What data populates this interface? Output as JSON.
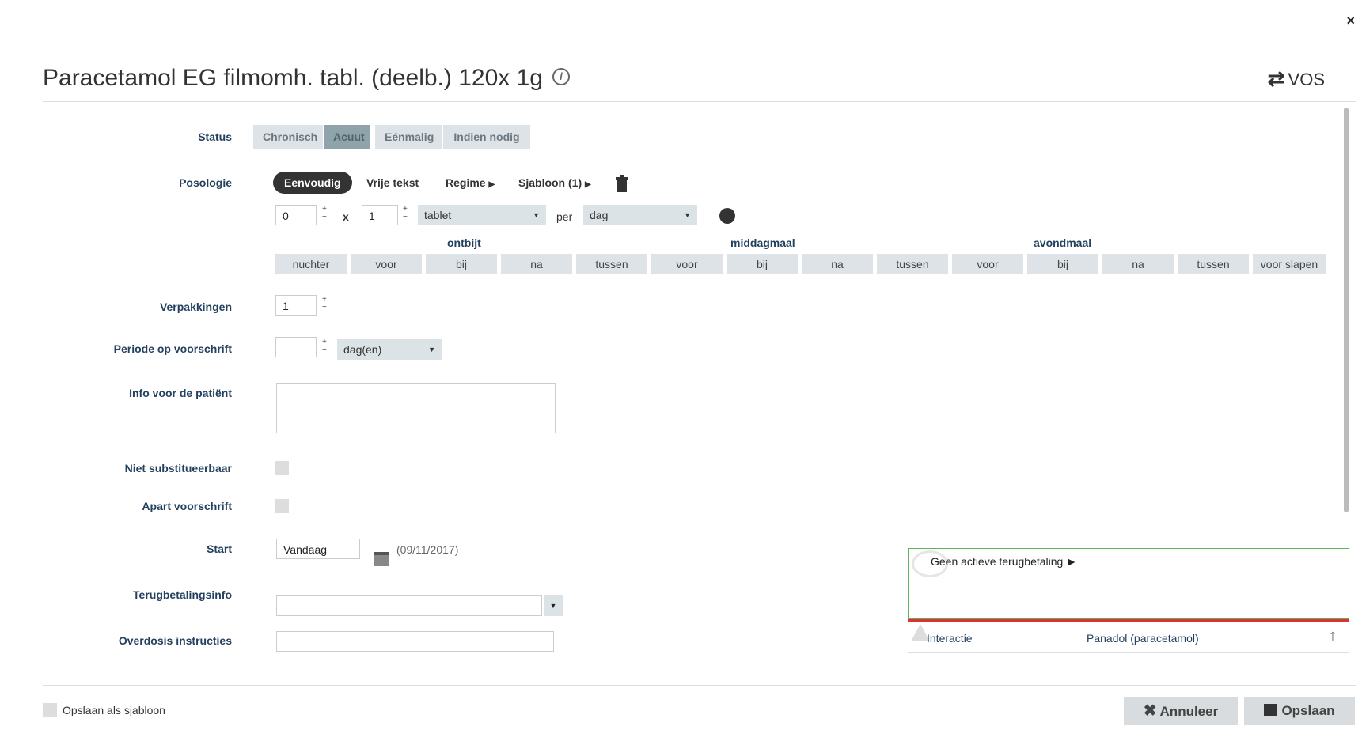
{
  "header": {
    "title": "Paracetamol EG filmomh. tabl. (deelb.) 120x 1g",
    "info_icon": "ⓘ",
    "vos_label": "VOS",
    "swap_icon": "⇄",
    "close_icon": "×"
  },
  "labels": {
    "status": "Status",
    "posologie": "Posologie",
    "verpakkingen": "Verpakkingen",
    "periode": "Periode op voorschrift",
    "info_patient": "Info voor de patiënt",
    "niet_subst": "Niet substitueerbaar",
    "apart": "Apart voorschrift",
    "start": "Start",
    "terugbetaling": "Terugbetalingsinfo",
    "overdosis": "Overdosis instructies"
  },
  "status": {
    "options": [
      "Chronisch",
      "Acuut",
      "Eénmalig",
      "Indien nodig"
    ],
    "selected": "Acuut"
  },
  "posologie_tabs": {
    "eenvoudig": "Eenvoudig",
    "vrije_tekst": "Vrije tekst",
    "regime": "Regime",
    "sjabloon": "Sjabloon (1)"
  },
  "dosage": {
    "amount": "0",
    "times_label": "x",
    "quantity": "1",
    "unit": "tablet",
    "per_label": "per",
    "period": "dag"
  },
  "meals": {
    "ontbijt": "ontbijt",
    "middagmaal": "middagmaal",
    "avondmaal": "avondmaal"
  },
  "slots": [
    "nuchter",
    "voor",
    "bij",
    "na",
    "tussen",
    "voor",
    "bij",
    "na",
    "tussen",
    "voor",
    "bij",
    "na",
    "tussen",
    "voor slapen"
  ],
  "verpakkingen_value": "1",
  "periode": {
    "value": "",
    "unit": "dag(en)"
  },
  "start": {
    "value": "Vandaag",
    "date": "(09/11/2017)"
  },
  "refund": {
    "text": "Geen actieve terugbetaling ►"
  },
  "interaction": {
    "label": "Interactie",
    "drug": "Panadol (paracetamol)",
    "arrow": "↑"
  },
  "footer": {
    "save_template": "Opslaan als sjabloon",
    "cancel": "Annuleer",
    "save": "Opslaan"
  },
  "colors": {
    "label_blue": "#23405e",
    "segment_bg": "#dde3e6",
    "segment_active": "#8fa3ab",
    "refund_border": "#5bb35b",
    "alert_red": "#e03030"
  }
}
